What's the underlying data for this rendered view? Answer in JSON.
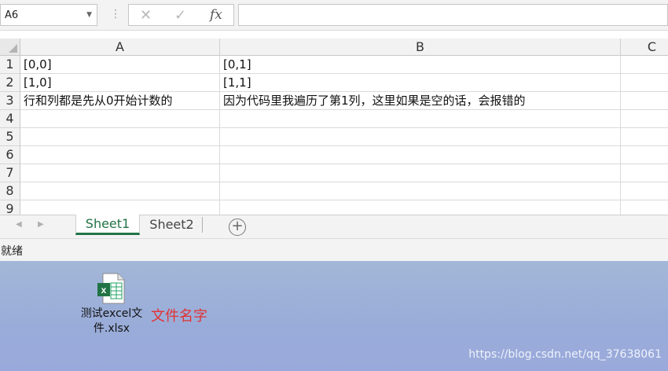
{
  "formula_bar": {
    "name_box": "A6",
    "fx_label": "fx",
    "formula": ""
  },
  "columns": [
    "A",
    "B",
    "C"
  ],
  "rows": [
    "1",
    "2",
    "3",
    "4",
    "5",
    "6",
    "7",
    "8",
    "9"
  ],
  "cells": {
    "A1": "[0,0]",
    "B1": " [0,1]",
    "A2": "[1,0]",
    "B2": "[1,1]",
    "A3": "行和列都是先从0开始计数的",
    "B3": "因为代码里我遍历了第1列，这里如果是空的话，会报错的"
  },
  "sheet_tabs": [
    "Sheet1",
    "Sheet2"
  ],
  "active_sheet": "Sheet1",
  "status": "就绪",
  "desktop": {
    "file_name": "测试excel文件.xlsx",
    "annotation": "文件名字",
    "watermark": "https://blog.csdn.net/qq_37638061"
  },
  "colors": {
    "excel_green": "#217346",
    "annotation_red": "#e23333"
  },
  "icons": {
    "cancel": "close-icon",
    "enter": "check-icon",
    "function": "function-icon",
    "add_sheet": "plus-circle-icon",
    "file": "excel-file-icon"
  }
}
